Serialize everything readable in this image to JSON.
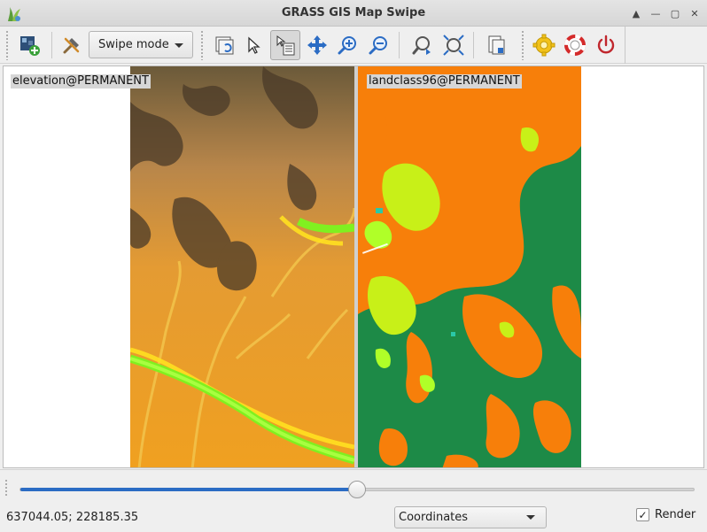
{
  "window": {
    "title": "GRASS GIS Map Swipe"
  },
  "toolbar": {
    "swipe_mode_label": "Swipe mode",
    "tools": [
      {
        "name": "add-map-icon"
      },
      {
        "name": "tools-icon"
      },
      {
        "name": "display-map-icon"
      },
      {
        "name": "pointer-icon"
      },
      {
        "name": "query-icon"
      },
      {
        "name": "pan-icon"
      },
      {
        "name": "zoom-in-icon"
      },
      {
        "name": "zoom-out-icon"
      },
      {
        "name": "zoom-back-icon"
      },
      {
        "name": "zoom-extent-icon"
      },
      {
        "name": "save-image-icon"
      },
      {
        "name": "settings-icon"
      },
      {
        "name": "help-icon"
      },
      {
        "name": "quit-icon"
      }
    ]
  },
  "maps": {
    "left_label": "elevation@PERMANENT",
    "right_label": "landclass96@PERMANENT"
  },
  "slider": {
    "value": 0.5
  },
  "status": {
    "coordinates": "637044.05; 228185.35",
    "display_mode": "Coordinates",
    "render_label": "Render",
    "render_checked": true
  },
  "colors": {
    "accent": "#2b6cc4",
    "quit": "#c0272d"
  }
}
